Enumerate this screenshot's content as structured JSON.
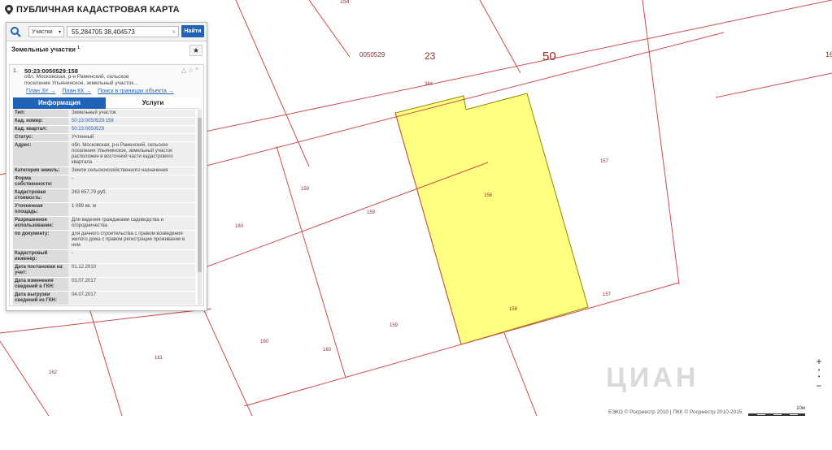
{
  "app": {
    "title": "ПУБЛИЧНАЯ КАДАСТРОВАЯ КАРТА"
  },
  "search": {
    "type_label": "Участки",
    "query": "55,284705 38,404573",
    "button": "Найти"
  },
  "panel": {
    "section_title": "Земельные участки",
    "section_count": "1",
    "card": {
      "index": "1.",
      "cad_number": "50:23:0050529:158",
      "address": "обл. Московская, р-н Раменский, сельское поселение Ульянинское, земельный участок...",
      "links": [
        "План ЗУ →",
        "План КК →",
        "Поиск в границах объекта →"
      ],
      "tabs": [
        "Информация",
        "Услуги"
      ],
      "rows": [
        {
          "k": "Тип:",
          "v": "Земельный участок"
        },
        {
          "k": "Кад. номер:",
          "v": "50:23:0050529:158"
        },
        {
          "k": "Кад. квартал:",
          "v": "50:23:0050529"
        },
        {
          "k": "Статус:",
          "v": "Учтенный"
        },
        {
          "k": "Адрес:",
          "v": "обл. Московская, р-н Раменский, сельское поселение Ульянинское, земельный участок расположен в восточной части кадастрового квартала"
        },
        {
          "k": "Категория земель:",
          "v": "Земли сельскохозяйственного назначения"
        },
        {
          "k": "Форма собственности:",
          "v": "-"
        },
        {
          "k": "Кадастровая стоимость:",
          "v": "263 657,79 руб."
        },
        {
          "k": "Уточненная площадь:",
          "v": "1 089 кв. м"
        },
        {
          "k": "Разрешенное использование:",
          "v": "Для ведения гражданами садоводства и огородничества"
        },
        {
          "k": "по документу:",
          "v": "для дачного строительства с правом возведения жилого дома с правом регистрации проживания в нем"
        },
        {
          "k": "Кадастровый инженер:",
          "v": "-"
        },
        {
          "k": "Дата постановки на учет:",
          "v": "01.12.2010"
        },
        {
          "k": "Дата изменения сведений в ГКН:",
          "v": "03.07.2017"
        },
        {
          "k": "Дата выгрузки сведений из ГКН:",
          "v": "04.07.2017"
        }
      ]
    }
  },
  "map": {
    "labels": {
      "quarter": "0050529",
      "district": "23",
      "region": "50",
      "p154": "154",
      "p364": "364",
      "p158": "158",
      "p157a": "157",
      "p157b": "157",
      "p158b": "158",
      "p159a": "159",
      "p159b": "159",
      "p159c": "159",
      "p160a": "160",
      "p160b": "160",
      "p160c": "160",
      "p161": "161",
      "p162": "162",
      "p162b": "162",
      "p161b": "161"
    },
    "highlight_color": "#ffff80",
    "boundary_color": "#d24a4a"
  },
  "footer": {
    "copyright": "ЕЭКО © Росреестр 2010 | ПКК © Росреестр 2010-2015",
    "scale": "10м",
    "watermark": "ЦИАН"
  }
}
